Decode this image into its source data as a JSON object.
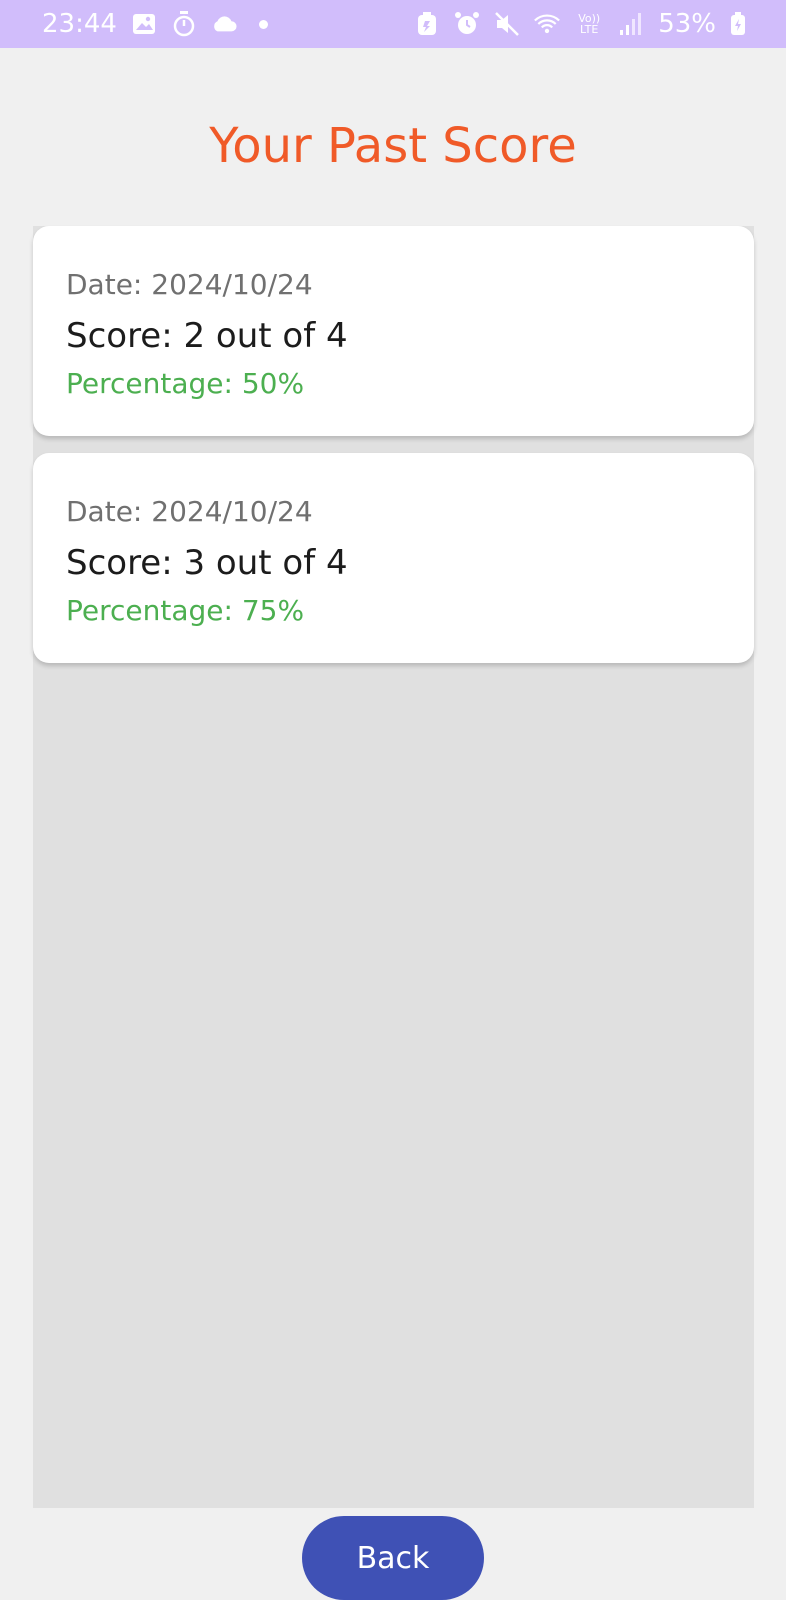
{
  "status_bar": {
    "time": "23:44",
    "battery": "53%",
    "network_label": "Vo)) LTE",
    "left_icons": [
      "gallery-icon",
      "timer-icon",
      "cloud-icon",
      "notification-dot-icon"
    ],
    "right_icons": [
      "battery-saver-icon",
      "alarm-icon",
      "mute-icon",
      "wifi-icon",
      "volte-icon",
      "signal-icon",
      "battery-icon"
    ]
  },
  "title": "Your Past Score",
  "scores": [
    {
      "date": "Date: 2024/10/24",
      "score": "Score: 2 out of 4",
      "percentage": "Percentage: 50%"
    },
    {
      "date": "Date: 2024/10/24",
      "score": "Score: 3 out of 4",
      "percentage": "Percentage: 75%"
    }
  ],
  "back_label": "Back",
  "colors": {
    "status_bar": "#d1bdfb",
    "title": "#f05a28",
    "percentage": "#4caf50",
    "button": "#3f51b5",
    "list_background": "#e0e0e0"
  }
}
